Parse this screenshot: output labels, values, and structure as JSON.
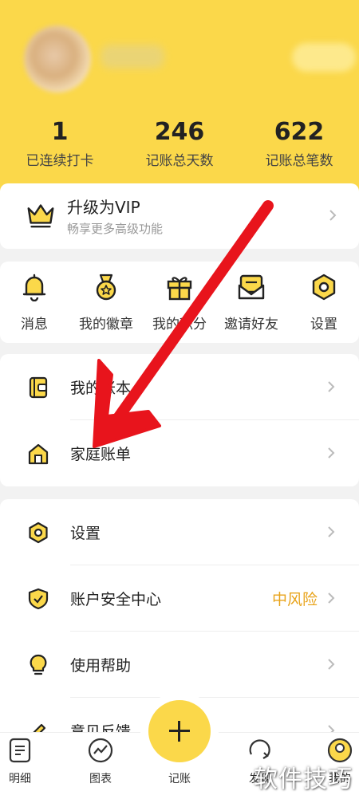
{
  "profile": {
    "avatar_icon": "user-avatar",
    "nickname_hidden": true
  },
  "stats": [
    {
      "value": "1",
      "label": "已连续打卡"
    },
    {
      "value": "246",
      "label": "记账总天数"
    },
    {
      "value": "622",
      "label": "记账总笔数"
    }
  ],
  "vip": {
    "title": "升级为VIP",
    "subtitle": "畅享更多高级功能",
    "icon": "crown-icon"
  },
  "quick_actions": [
    {
      "label": "消息",
      "icon": "bell-icon"
    },
    {
      "label": "我的徽章",
      "icon": "medal-icon"
    },
    {
      "label": "我的积分",
      "icon": "gift-icon"
    },
    {
      "label": "邀请好友",
      "icon": "envelope-icon"
    },
    {
      "label": "设置",
      "icon": "hexagon-settings-icon"
    }
  ],
  "menu_group1": [
    {
      "label": "我的账本",
      "icon": "wallet-icon"
    },
    {
      "label": "家庭账单",
      "icon": "house-icon"
    }
  ],
  "menu_group2": [
    {
      "label": "设置",
      "icon": "settings-icon"
    },
    {
      "label": "账户安全中心",
      "icon": "shield-icon",
      "value": "中风险"
    },
    {
      "label": "使用帮助",
      "icon": "lightbulb-icon"
    },
    {
      "label": "意见反馈",
      "icon": "feedback-icon"
    }
  ],
  "tabbar": {
    "tabs": [
      {
        "label": "明细",
        "icon": "document-icon"
      },
      {
        "label": "图表",
        "icon": "chart-icon"
      },
      {
        "label": "记账",
        "icon": "plus-icon"
      },
      {
        "label": "发现",
        "icon": "discover-icon"
      },
      {
        "label": "我的",
        "icon": "profile-icon"
      }
    ]
  },
  "watermark": "软件技巧",
  "colors": {
    "brand_yellow": "#fbd84a",
    "risk_orange": "#e8a31a",
    "annotation_red": "#e8141c"
  }
}
